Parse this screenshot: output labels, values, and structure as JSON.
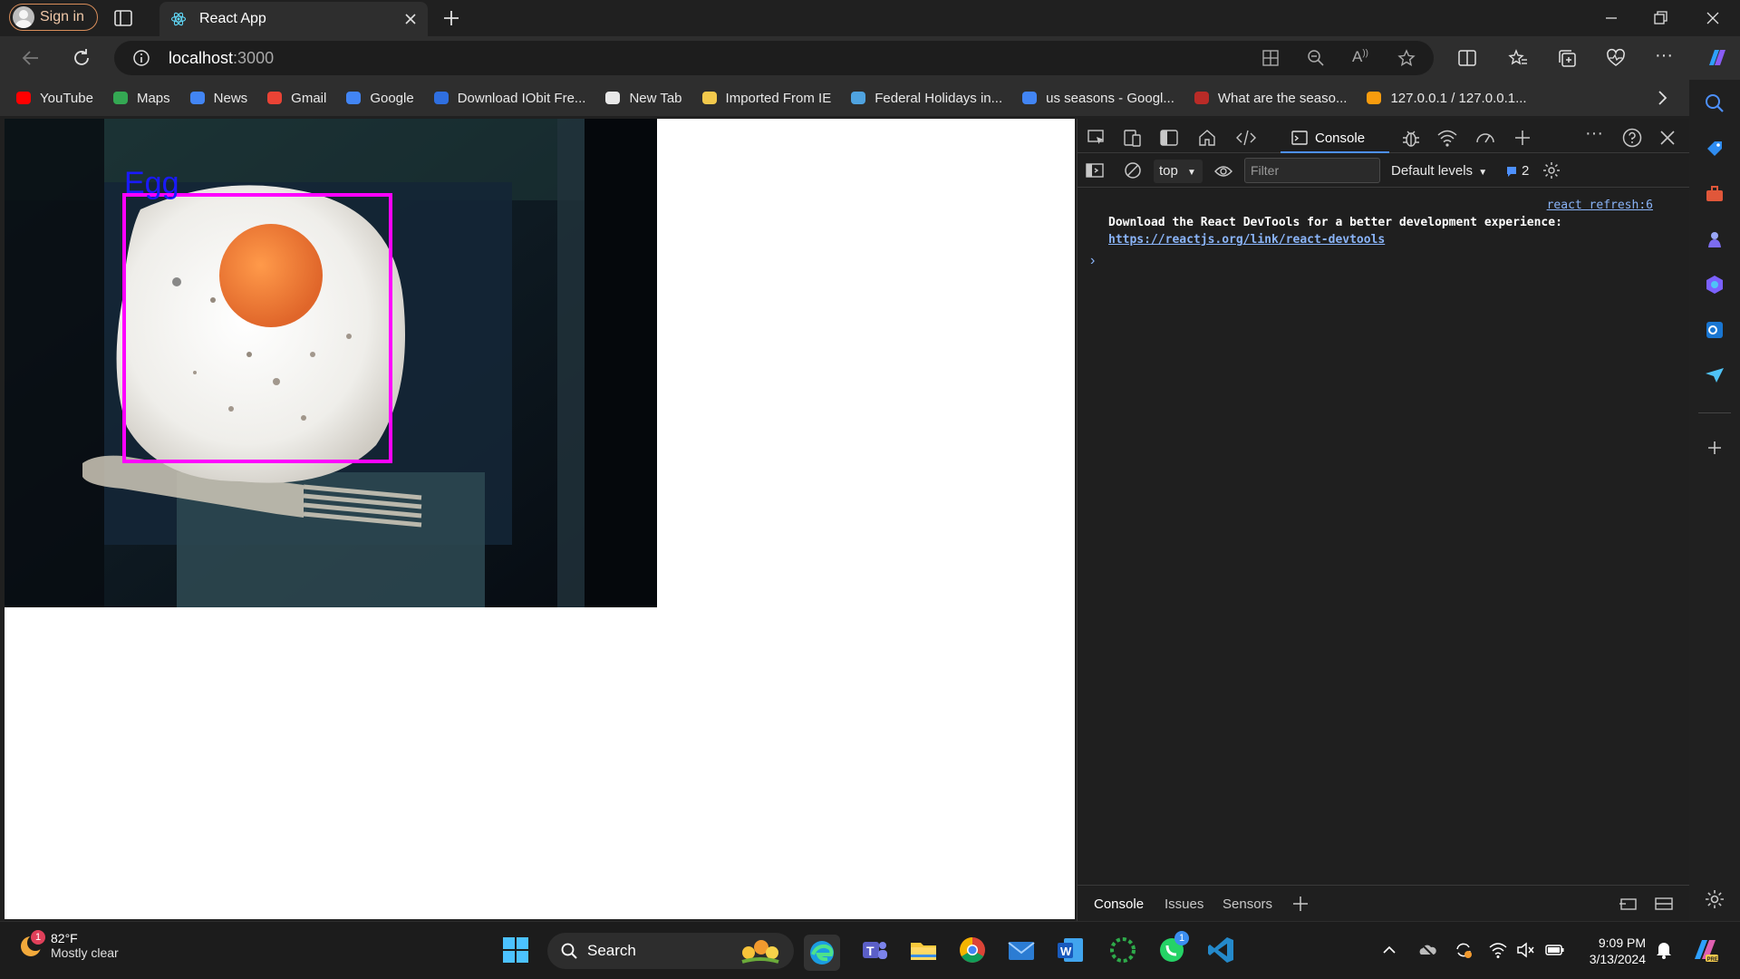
{
  "window": {
    "sign_in_label": "Sign in",
    "tab_title": "React App"
  },
  "address_bar": {
    "host": "localhost",
    "port": ":3000"
  },
  "bookmarks": [
    {
      "label": "YouTube",
      "icon": "youtube-icon",
      "color": "#ff0000"
    },
    {
      "label": "Maps",
      "icon": "maps-icon",
      "color": "#34a853"
    },
    {
      "label": "News",
      "icon": "news-icon",
      "color": "#4285f4"
    },
    {
      "label": "Gmail",
      "icon": "gmail-icon",
      "color": "#ea4335"
    },
    {
      "label": "Google",
      "icon": "google-icon",
      "color": "#4285f4"
    },
    {
      "label": "Download IObit Fre...",
      "icon": "iobit-icon",
      "color": "#2f6fe0"
    },
    {
      "label": "New Tab",
      "icon": "page-icon",
      "color": "#e8e8e8"
    },
    {
      "label": "Imported From IE",
      "icon": "folder-icon",
      "color": "#f2c94c"
    },
    {
      "label": "Federal Holidays in...",
      "icon": "calendar-icon",
      "color": "#4fa3e0"
    },
    {
      "label": "us seasons - Googl...",
      "icon": "google-icon",
      "color": "#4285f4"
    },
    {
      "label": "What are the seaso...",
      "icon": "quora-icon",
      "color": "#b92b27"
    },
    {
      "label": "127.0.0.1 / 127.0.0.1...",
      "icon": "phpmyadmin-icon",
      "color": "#f89c0e"
    }
  ],
  "detection": {
    "label": "Egg",
    "box_color": "#ff00ff",
    "label_color": "#1a1aff"
  },
  "devtools": {
    "console_tab": "Console",
    "context": "top",
    "filter_placeholder": "Filter",
    "levels": "Default levels",
    "issues_count": "2",
    "message": {
      "source": "react refresh:6",
      "text": "Download the React DevTools for a better development experience: ",
      "link": "https://reactjs.org/link/react-devtools"
    },
    "drawer_tabs": [
      "Console",
      "Issues",
      "Sensors"
    ]
  },
  "taskbar": {
    "weather_temp": "82°F",
    "weather_condition": "Mostly clear",
    "weather_badge": "1",
    "search_label": "Search",
    "whatsapp_badge": "1",
    "time": "9:09 PM",
    "date": "3/13/2024"
  }
}
